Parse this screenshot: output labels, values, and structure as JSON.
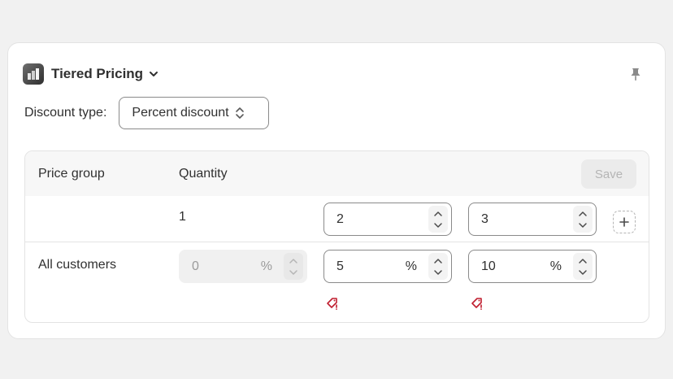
{
  "app": {
    "title": "Tiered Pricing"
  },
  "discount": {
    "label": "Discount type:",
    "selected": "Percent discount"
  },
  "table": {
    "col_group": "Price group",
    "col_quantity": "Quantity",
    "save_label": "Save",
    "quantities": {
      "first": "1",
      "second": "2",
      "third": "3"
    },
    "row": {
      "label": "All customers",
      "unit": "%",
      "discounts": {
        "first": "0",
        "second": "5",
        "third": "10"
      }
    }
  },
  "colors": {
    "accent_warning": "#c01e2f",
    "border": "#8a8a8a",
    "muted": "#b5b5b5"
  },
  "icons": [
    "app-logo-icon",
    "chevron-down-icon",
    "pin-icon",
    "select-updown-icon",
    "stepper-up-icon",
    "stepper-down-icon",
    "plus-icon",
    "discount-tag-icon"
  ]
}
